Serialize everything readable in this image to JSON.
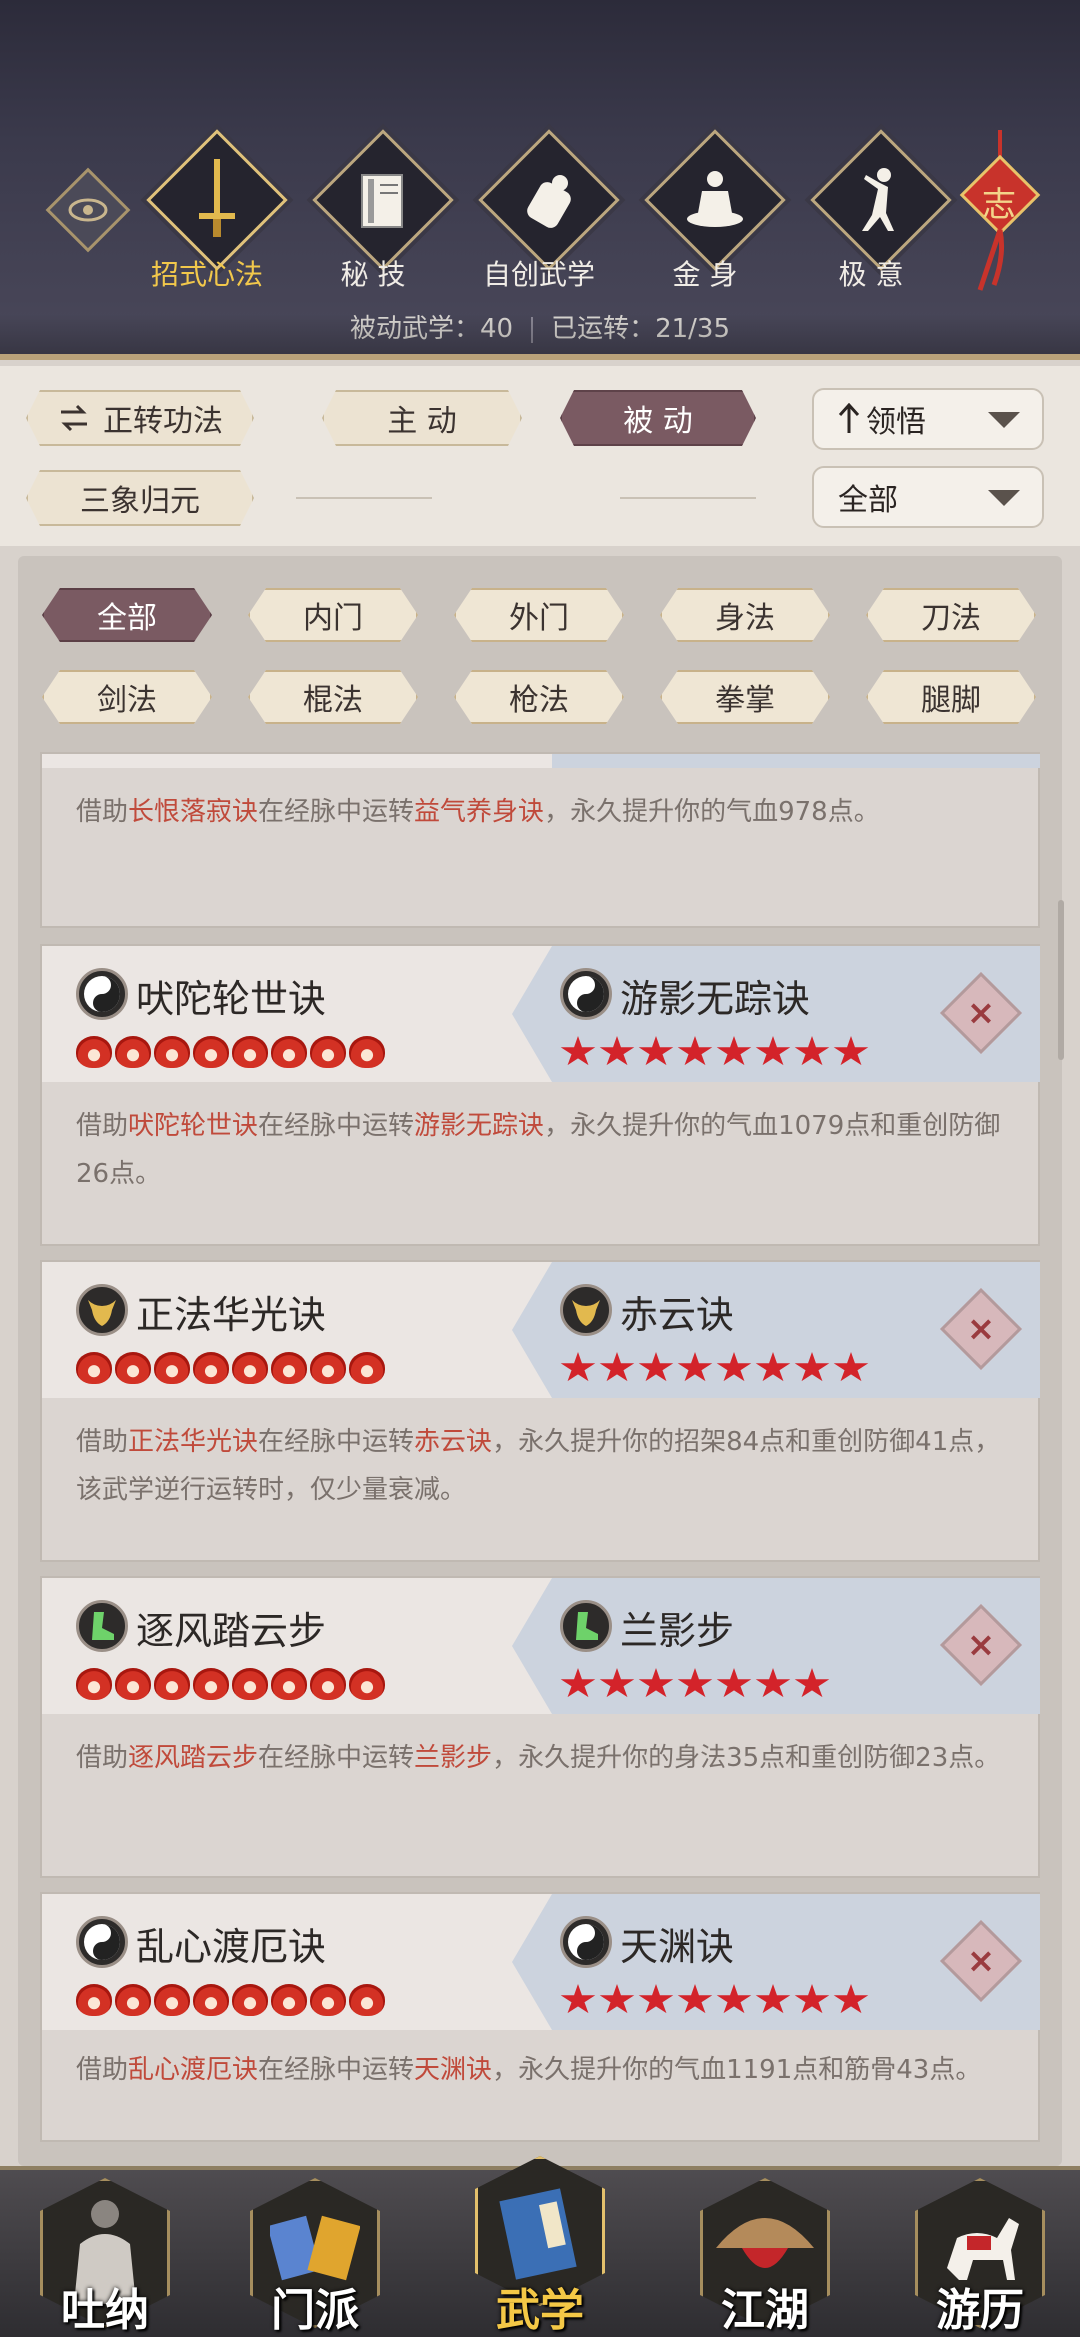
{
  "top_tabs": [
    {
      "label": "招式心法",
      "icon": "sword-icon",
      "active": true
    },
    {
      "label": "秘 技",
      "icon": "book-icon",
      "active": false
    },
    {
      "label": "自创武学",
      "icon": "scroll-icon",
      "active": false
    },
    {
      "label": "金 身",
      "icon": "meditation-icon",
      "active": false
    },
    {
      "label": "极 意",
      "icon": "fighter-icon",
      "active": false
    }
  ],
  "knot_char": "志",
  "stats": {
    "passive": "被动武学：40",
    "running": "已运转：21/35"
  },
  "filter": {
    "reverse_btn": "正转功法",
    "active_tab": "主 动",
    "passive_tab": "被 动",
    "sort_dropdown": "领悟",
    "sanxiang_btn": "三象归元",
    "scope_dropdown": "全部"
  },
  "categories": [
    "全部",
    "内门",
    "外门",
    "身法",
    "刀法",
    "剑法",
    "棍法",
    "枪法",
    "拳掌",
    "腿脚"
  ],
  "cards": [
    {
      "left_name": "",
      "right_name": "",
      "desc_pre": "借助",
      "desc_a": "长恨落寂诀",
      "desc_mid": "在经脉中运转",
      "desc_b": "益气养身诀",
      "desc_post": "，永久提升你的气血978点。"
    },
    {
      "left_name": "吠陀轮世诀",
      "right_name": "游影无踪诀",
      "left_icon": "yinyang-icon",
      "right_icon": "yinyang-icon",
      "left_ranks": 8,
      "right_ranks": 8,
      "desc_pre": "借助",
      "desc_a": "吠陀轮世诀",
      "desc_mid": "在经脉中运转",
      "desc_b": "游影无踪诀",
      "desc_post": "，永久提升你的气血1079点和重创防御26点。"
    },
    {
      "left_name": "正法华光诀",
      "right_name": "赤云诀",
      "left_icon": "bull-icon",
      "right_icon": "bull-icon",
      "left_ranks": 8,
      "right_ranks": 8,
      "desc_pre": "借助",
      "desc_a": "正法华光诀",
      "desc_mid": "在经脉中运转",
      "desc_b": "赤云诀",
      "desc_post": "，永久提升你的招架84点和重创防御41点，该武学逆行运转时，仅少量衰减。"
    },
    {
      "left_name": "逐风踏云步",
      "right_name": "兰影步",
      "left_icon": "boot-icon",
      "right_icon": "boot-icon",
      "left_ranks": 8,
      "right_ranks": 7,
      "desc_pre": "借助",
      "desc_a": "逐风踏云步",
      "desc_mid": "在经脉中运转",
      "desc_b": "兰影步",
      "desc_post": "，永久提升你的身法35点和重创防御23点。"
    },
    {
      "left_name": "乱心渡厄诀",
      "right_name": "天渊诀",
      "left_icon": "yinyang-icon",
      "right_icon": "yinyang-icon",
      "left_ranks": 8,
      "right_ranks": 8,
      "desc_pre": "借助",
      "desc_a": "乱心渡厄诀",
      "desc_mid": "在经脉中运转",
      "desc_b": "天渊诀",
      "desc_post": "，永久提升你的气血1191点和筋骨43点。"
    }
  ],
  "bottom_nav": [
    {
      "label": "吐纳",
      "icon": "monk-icon",
      "active": false
    },
    {
      "label": "门派",
      "icon": "sect-icon",
      "active": false
    },
    {
      "label": "武学",
      "icon": "martial-book-icon",
      "active": true
    },
    {
      "label": "江湖",
      "icon": "straw-hat-icon",
      "active": false
    },
    {
      "label": "游历",
      "icon": "horse-icon",
      "active": false
    }
  ]
}
